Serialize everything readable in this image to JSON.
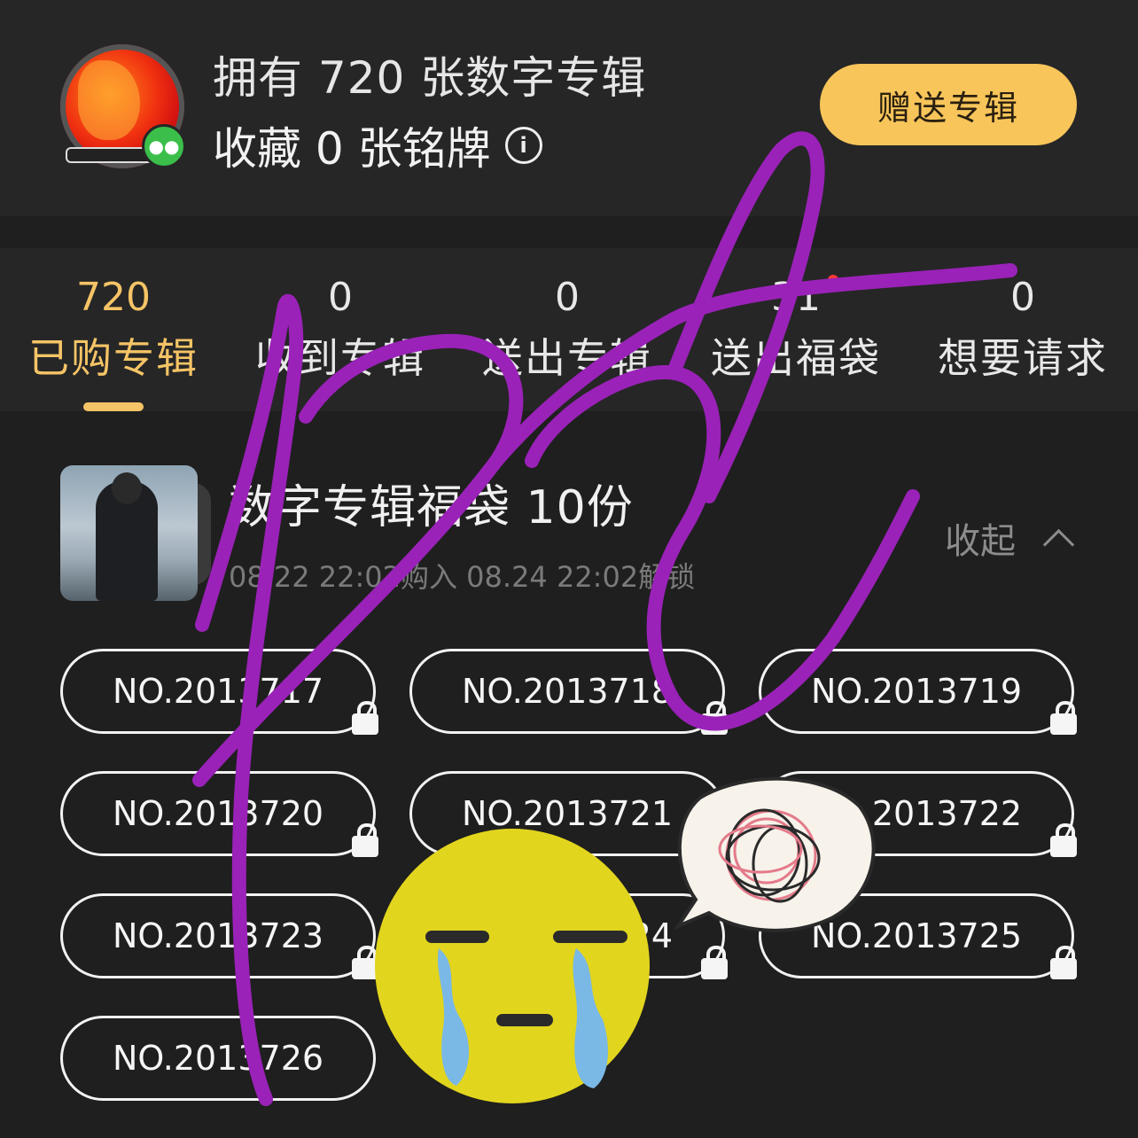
{
  "header": {
    "own_text": "拥有 720 张数字专辑",
    "collect_text": "收藏 0 张铭牌",
    "info_icon": "info-icon",
    "gift_button": "赠送专辑"
  },
  "tabs": [
    {
      "count": "720",
      "label": "已购专辑",
      "active": true
    },
    {
      "count": "0",
      "label": "收到专辑"
    },
    {
      "count": "0",
      "label": "送出专辑"
    },
    {
      "count": "31",
      "label": "送出福袋",
      "has_dot": true
    },
    {
      "count": "0",
      "label": "想要请求"
    }
  ],
  "bag": {
    "title": "数字专辑福袋 10份",
    "time": "08.22 22:02购入 08.24 22:02解锁",
    "collapse_label": "收起"
  },
  "numbers": [
    "NO.2013717",
    "NO.2013718",
    "NO.2013719",
    "NO.2013720",
    "NO.2013721",
    "NO.2013722",
    "NO.2013723",
    "NO.2013724",
    "NO.2013725",
    "NO.2013726"
  ],
  "colors": {
    "accent": "#f5c466",
    "button": "#f8c55a",
    "background": "#1f1f1f",
    "scribble": "#9a22b8",
    "emoji": "#e2d51e",
    "tears": "#7ab8e6"
  }
}
